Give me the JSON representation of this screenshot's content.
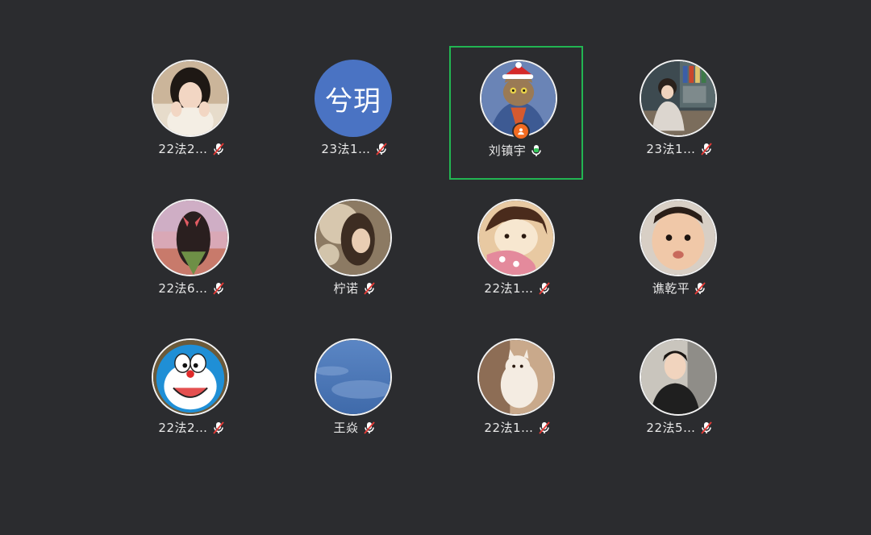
{
  "participants": [
    {
      "name": "22法2…",
      "muted": true,
      "avatar_type": "photo",
      "avatar_desc": "girl-portrait"
    },
    {
      "name": "23法1…",
      "muted": true,
      "avatar_type": "text",
      "avatar_text": "兮玥",
      "avatar_color": "#4a73c3"
    },
    {
      "name": "刘镇宇",
      "muted": false,
      "speaking": true,
      "host": true,
      "avatar_type": "photo",
      "avatar_desc": "cat-santa-hat"
    },
    {
      "name": "23法1…",
      "muted": true,
      "avatar_type": "photo",
      "avatar_desc": "girl-bookshelf"
    },
    {
      "name": "22法6…",
      "muted": true,
      "avatar_type": "photo",
      "avatar_desc": "girl-ribbon"
    },
    {
      "name": "柠诺",
      "muted": true,
      "avatar_type": "photo",
      "avatar_desc": "girl-light"
    },
    {
      "name": "22法1…",
      "muted": true,
      "avatar_type": "photo",
      "avatar_desc": "cartoon-girl"
    },
    {
      "name": "谯乾平",
      "muted": true,
      "avatar_type": "photo",
      "avatar_desc": "baby-face"
    },
    {
      "name": "22法2…",
      "muted": true,
      "avatar_type": "photo",
      "avatar_desc": "doraemon"
    },
    {
      "name": "王焱",
      "muted": true,
      "avatar_type": "photo",
      "avatar_desc": "sky-clouds"
    },
    {
      "name": "22法1…",
      "muted": true,
      "avatar_type": "photo",
      "avatar_desc": "kitten"
    },
    {
      "name": "22法5…",
      "muted": true,
      "avatar_type": "photo",
      "avatar_desc": "boy-portrait"
    }
  ],
  "colors": {
    "background": "#2b2c2f",
    "active_border": "#22b552",
    "mic_muted": "#ffffff",
    "mic_slash": "#e53935",
    "mic_active": "#34c759",
    "host_badge": "#f26b21"
  }
}
